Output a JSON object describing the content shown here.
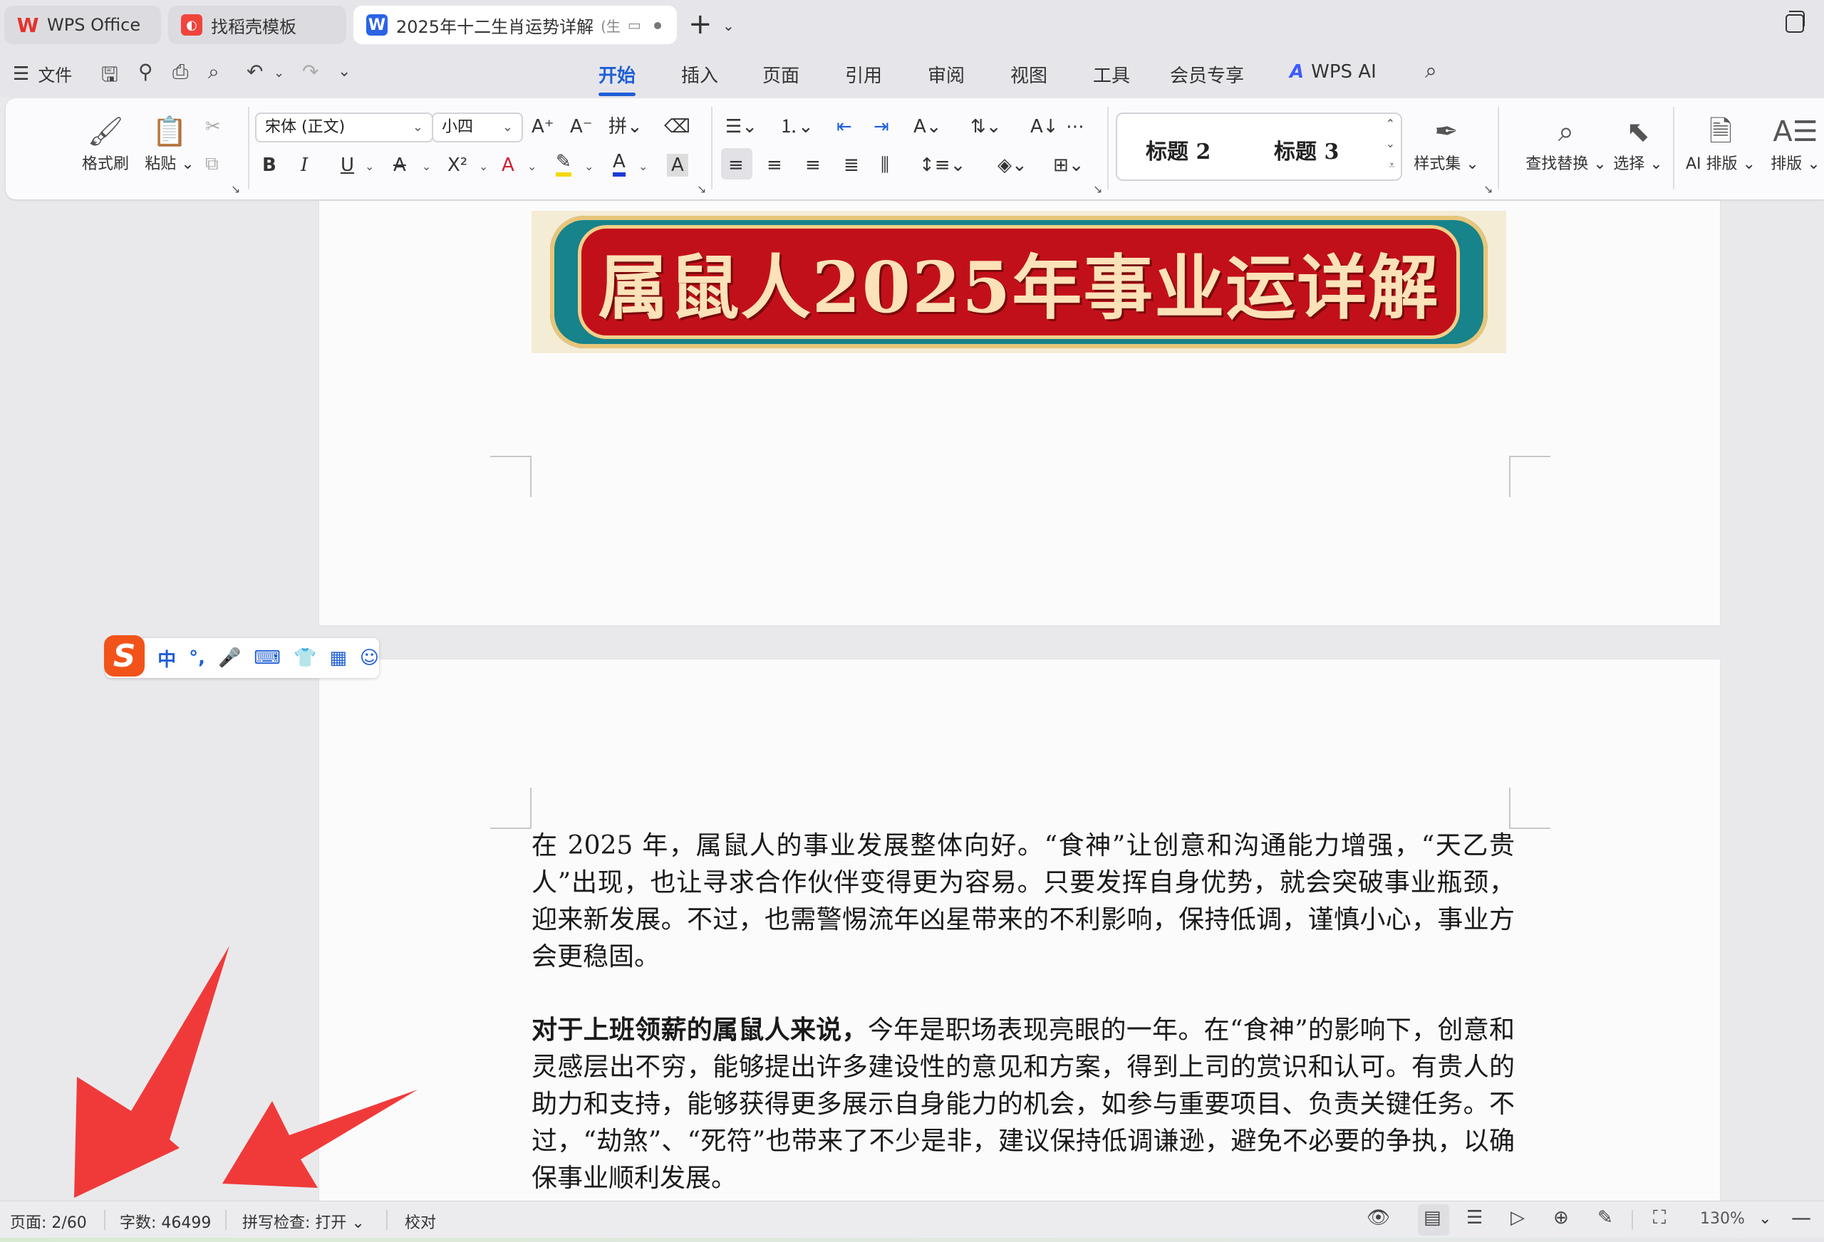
{
  "tabs": [
    {
      "label": "WPS Office",
      "icon": "wps-logo-icon"
    },
    {
      "label": "找稻壳模板",
      "icon": "docer-icon"
    },
    {
      "label": "2025年十二生肖运势详解",
      "suffix": "(生",
      "icon": "word-doc-icon",
      "active": true
    }
  ],
  "menu": {
    "file_label": "文件",
    "ribbon_tabs": [
      "开始",
      "插入",
      "页面",
      "引用",
      "审阅",
      "视图",
      "工具",
      "会员专享"
    ],
    "active_tab": "开始",
    "wps_ai_label": "WPS AI"
  },
  "ribbon": {
    "format_painter": "格式刷",
    "paste": "粘贴",
    "font_name": "宋体 (正文)",
    "font_size": "小四",
    "styles": [
      "标题 2",
      "标题 3"
    ],
    "style_set": "样式集",
    "find_replace": "查找替换",
    "select": "选择",
    "ai_layout": "AI 排版",
    "layout": "排版",
    "bold": "B",
    "italic": "I",
    "underline": "U",
    "strike": "A",
    "superscript": "X²",
    "font_color_letter": "A",
    "highlight_color": "#f5d90a",
    "font_color": "#1b3bd6"
  },
  "document": {
    "banner_title": "属鼠人2025年事业运详解",
    "paragraph_1": "在 2025 年，属鼠人的事业发展整体向好。“食神”让创意和沟通能力增强，“天乙贵人”出现，也让寻求合作伙伴变得更为容易。只要发挥自身优势，就会突破事业瓶颈，迎来新发展。不过，也需警惕流年凶星带来的不利影响，保持低调，谨慎小心，事业方会更稳固。",
    "paragraph_2_bold": "对于上班领薪的属鼠人来说，",
    "paragraph_2_rest": "今年是职场表现亮眼的一年。在“食神”的影响下，创意和灵感层出不穷，能够提出许多建设性的意见和方案，得到上司的赏识和认可。有贵人的助力和支持，能够获得更多展示自身能力的机会，如参与重要项目、负责关键任务。不过，“劫煞”、“死符”也带来了不少是非，建议保持低调谦逊，避免不必要的争执，以确保事业顺利发展。"
  },
  "ime": {
    "logo": "S",
    "mode": "中",
    "punct": "°,"
  },
  "status": {
    "page": "页面: 2/60",
    "word_count": "字数: 46499",
    "spell_check": "拼写检查: 打开",
    "proofread": "校对",
    "zoom": "130%"
  },
  "annotation_color": "#f03a3a"
}
